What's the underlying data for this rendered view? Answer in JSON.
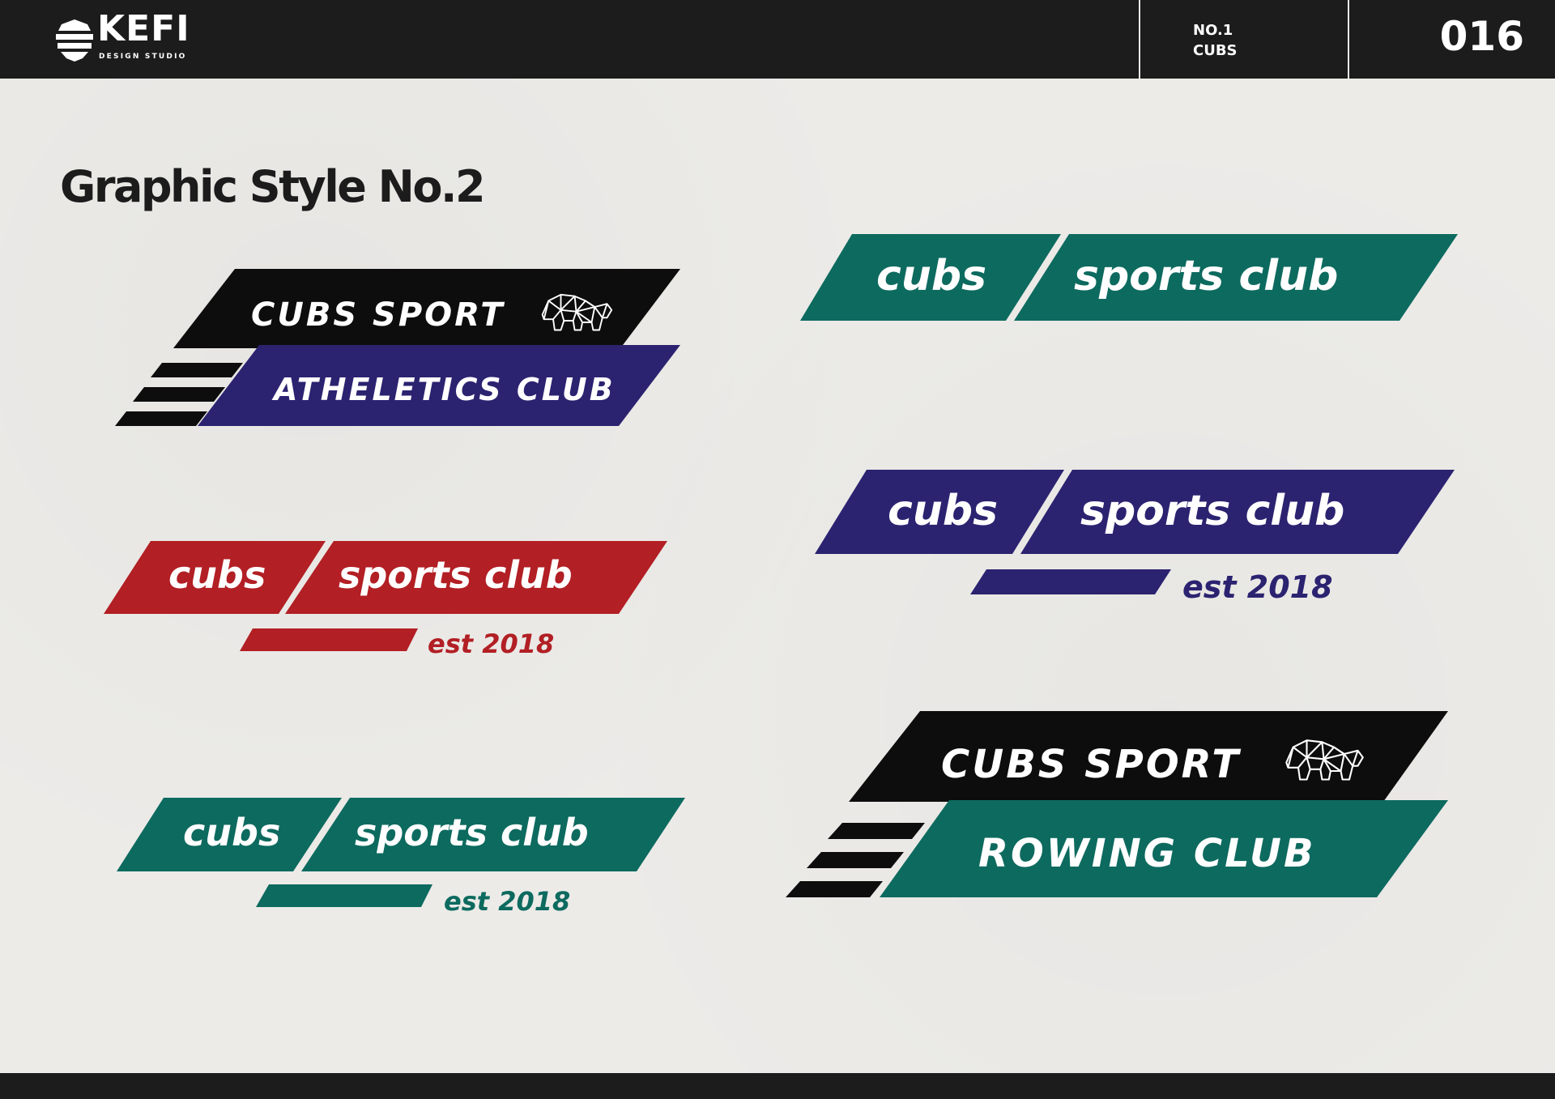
{
  "header": {
    "logo_word": "KEFI",
    "logo_sub": "DESIGN STUDIO",
    "project_line1": "NO.1",
    "project_line2": "CUBS",
    "page_number": "016"
  },
  "page_title": "Graphic Style No.2",
  "colors": {
    "black": "#0d0d0d",
    "navy": "#2b2370",
    "red": "#b21f24",
    "teal": "#0d6a5f",
    "background": "#ecebe8",
    "bar": "#1c1c1c"
  },
  "badges": {
    "athletics": {
      "line1": "CUBS SPORT",
      "line2": "ATHELETICS CLUB",
      "icon": "geometric-bear-icon"
    },
    "red": {
      "left": "cubs",
      "right": "sports club",
      "est": "est 2018"
    },
    "teal_left": {
      "left": "cubs",
      "right": "sports club",
      "est": "est 2018"
    },
    "teal_top": {
      "left": "cubs",
      "right": "sports club"
    },
    "navy": {
      "left": "cubs",
      "right": "sports club",
      "est": "est 2018"
    },
    "rowing": {
      "line1": "CUBS SPORT",
      "line2": "ROWING CLUB",
      "icon": "geometric-bear-icon"
    }
  }
}
